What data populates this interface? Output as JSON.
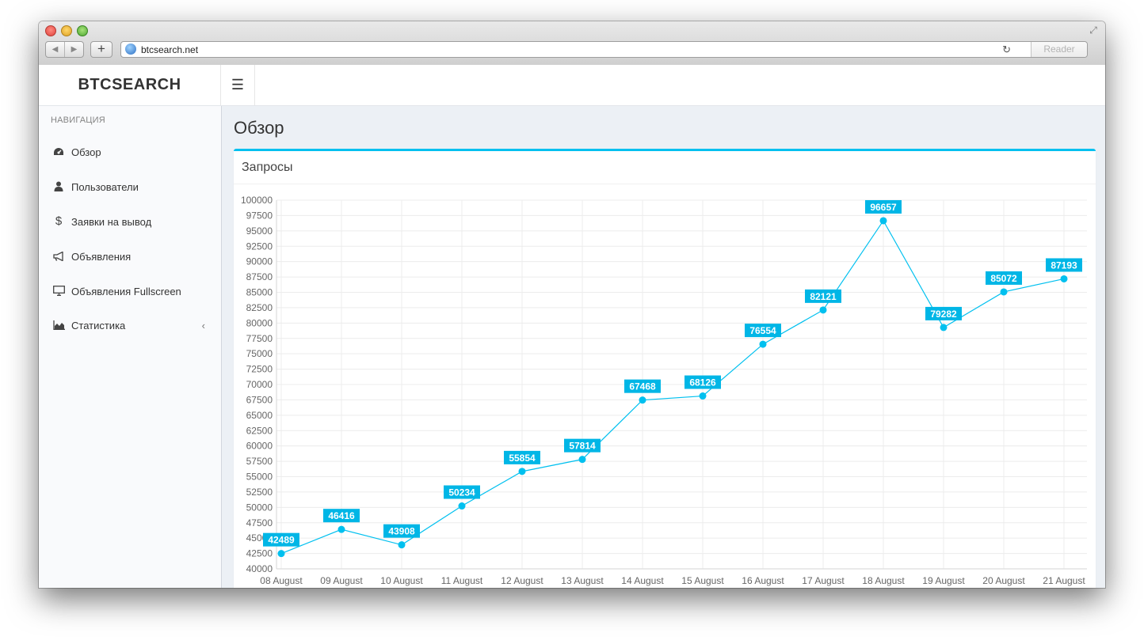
{
  "browser": {
    "url": "btcsearch.net",
    "reader_label": "Reader"
  },
  "header": {
    "logo": "BTCSEARCH"
  },
  "sidebar": {
    "header": "НАВИГАЦИЯ",
    "items": [
      {
        "label": "Обзор",
        "icon": "dashboard-icon"
      },
      {
        "label": "Пользователи",
        "icon": "user-icon"
      },
      {
        "label": "Заявки на вывод",
        "icon": "dollar-icon"
      },
      {
        "label": "Объявления",
        "icon": "bullhorn-icon"
      },
      {
        "label": "Объявления Fullscreen",
        "icon": "monitor-icon"
      },
      {
        "label": "Статистика",
        "icon": "area-chart-icon"
      }
    ]
  },
  "main": {
    "page_title": "Обзор",
    "box_title": "Запросы"
  },
  "colors": {
    "accent": "#00c0ef",
    "label_bg": "#00b6e6"
  },
  "chart_data": {
    "type": "line",
    "title": "Запросы",
    "categories": [
      "08 August",
      "09 August",
      "10 August",
      "11 August",
      "12 August",
      "13 August",
      "14 August",
      "15 August",
      "16 August",
      "17 August",
      "18 August",
      "19 August",
      "20 August",
      "21 August"
    ],
    "series": [
      {
        "values": [
          42489,
          46416,
          43908,
          50234,
          55854,
          57814,
          67468,
          68126,
          76554,
          82121,
          96657,
          79282,
          85072,
          87193
        ]
      }
    ],
    "ylim": [
      40000,
      100000
    ],
    "ytick_step": 2500,
    "grid": true,
    "data_labels": true
  }
}
